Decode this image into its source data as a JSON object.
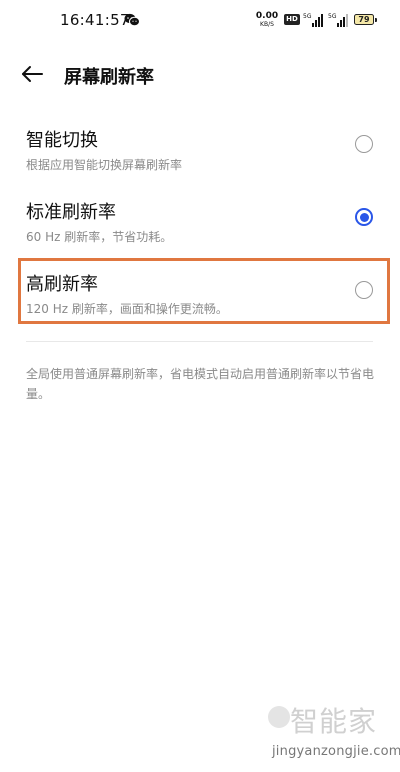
{
  "status_bar": {
    "time": "16:41:57",
    "net_speed_value": "0.00",
    "net_speed_unit": "KB/S",
    "hd_label": "HD",
    "battery_level": "79",
    "icons": [
      "wechat-icon",
      "signal-5g-icon",
      "signal-5g-icon",
      "battery-icon"
    ]
  },
  "header": {
    "title": "屏幕刷新率",
    "back_icon": "back-arrow-icon"
  },
  "options": [
    {
      "title": "智能切换",
      "subtitle": "根据应用智能切换屏幕刷新率",
      "selected": false
    },
    {
      "title": "标准刷新率",
      "subtitle": "60 Hz 刷新率，节省功耗。",
      "selected": true
    },
    {
      "title": "高刷新率",
      "subtitle": "120 Hz 刷新率，画面和操作更流畅。",
      "selected": false
    }
  ],
  "note": "全局使用普通屏幕刷新率，省电模式自动启用普通刷新率以节省电量。",
  "watermark": {
    "top": "智能家",
    "bottom": "jingyanzongjie.com"
  },
  "colors": {
    "accent": "#2a56e8",
    "highlight": "#e07740",
    "secondary_text": "#8a8a8a"
  }
}
